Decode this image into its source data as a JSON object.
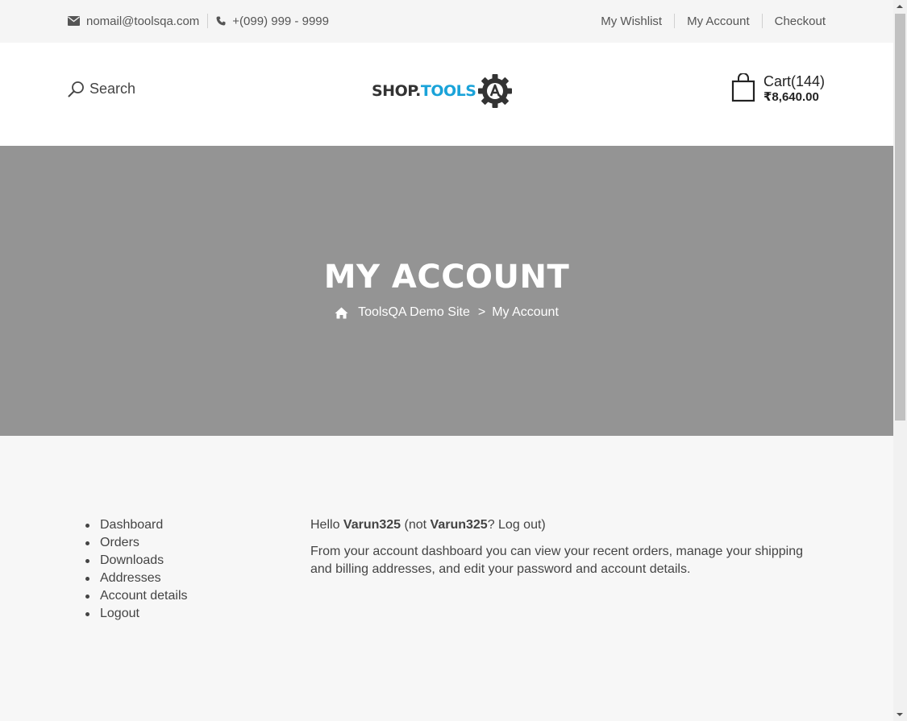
{
  "topbar": {
    "email": "nomail@toolsqa.com",
    "phone": "+(099) 999 - 9999",
    "links": [
      "My Wishlist",
      "My Account",
      "Checkout"
    ]
  },
  "header": {
    "search_label": "Search",
    "logo": {
      "part1": "SHOP.",
      "part2": "TOOLS",
      "mark": "QA"
    },
    "cart": {
      "count_label": "Cart(144)",
      "total": "₹8,640.00"
    }
  },
  "banner": {
    "title": "MY ACCOUNT",
    "breadcrumb": {
      "home": "ToolsQA Demo Site",
      "separator": ">",
      "current": "My Account"
    }
  },
  "account_nav": [
    "Dashboard",
    "Orders",
    "Downloads",
    "Addresses",
    "Account details",
    "Logout"
  ],
  "dashboard": {
    "hello_prefix": "Hello ",
    "username": "Varun325",
    "not_prefix": " (not ",
    "not_user": "Varun325",
    "logout_link": "? Log out)",
    "description": "From your account dashboard you can view your recent orders, manage your shipping and billing addresses, and edit your password and account details."
  },
  "colors": {
    "banner": "#949494",
    "accent": "#1aa3d9",
    "topbar": "#f5f5f5"
  },
  "icons": [
    "envelope-icon",
    "phone-icon",
    "search-icon",
    "gear-icon",
    "shopping-bag-icon",
    "home-icon"
  ]
}
